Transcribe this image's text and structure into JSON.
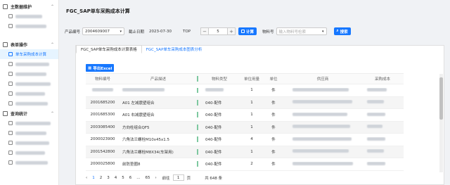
{
  "sidebar": {
    "groups": [
      {
        "label": "主数据维护",
        "items": [
          {
            "label": ""
          }
        ]
      },
      {
        "label": "表单操作",
        "items": [
          {
            "label": "单车采购成本计算",
            "active": true
          },
          {
            "label": ""
          },
          {
            "label": ""
          },
          {
            "label": ""
          },
          {
            "label": ""
          },
          {
            "label": ""
          }
        ]
      },
      {
        "label": "查询统计",
        "items": [
          {
            "label": ""
          },
          {
            "label": ""
          },
          {
            "label": ""
          },
          {
            "label": ""
          },
          {
            "label": ""
          },
          {
            "label": ""
          }
        ]
      }
    ]
  },
  "header": {
    "title": "FGC_SAP单车采购成本计算"
  },
  "filters": {
    "product_code_label": "产品编号",
    "product_code_value": "2004609007",
    "deadline_label": "截止日期",
    "deadline_value": "2023-07-30",
    "top_label": "TOP",
    "top_value": "5",
    "minus": "−",
    "plus": "+",
    "calc_button": "计算",
    "material_label": "物料号",
    "material_placeholder": "输入物料号检索",
    "search_button": "搜索"
  },
  "tabs": [
    {
      "label": "FGC_SAP单车采购成本计算表格",
      "active": true
    },
    {
      "label": "FGC_SAP单车采购成本图表分析",
      "active": false
    }
  ],
  "export_button": "导出Excel",
  "table": {
    "columns": [
      "物料编号",
      "产品描述",
      "物料类型",
      "单位用量",
      "单位",
      "供应商",
      "采购成本"
    ],
    "rows": [
      {
        "code": "",
        "desc": "",
        "type": "",
        "qty": "1",
        "unit": ""
      },
      {
        "code": "2001685200",
        "desc": "A01 左减震壁组合",
        "type": "040-配件",
        "qty": "1",
        "unit": "件"
      },
      {
        "code": "2001685300",
        "desc": "A01 右减震壁组合",
        "type": "040-配件",
        "qty": "1",
        "unit": "件"
      },
      {
        "code": "2003085400",
        "desc": "方向柱组合QF5",
        "type": "040-配件",
        "qty": "1",
        "unit": "件"
      },
      {
        "code": "2000023900",
        "desc": "六角法兰螺栓M10x45x1.5",
        "type": "040-配件",
        "qty": "4",
        "unit": "件"
      },
      {
        "code": "2001542800",
        "desc": "六角法兰螺栓M8X34(车架用)",
        "type": "040-配件",
        "qty": "1",
        "unit": "件"
      },
      {
        "code": "2000025800",
        "desc": "前防垫圈8",
        "type": "040-配件",
        "qty": "2",
        "unit": "件"
      }
    ]
  },
  "pagination": {
    "prev": "‹",
    "pages": [
      "1",
      "2",
      "3",
      "4",
      "5",
      "6",
      "...",
      "65"
    ],
    "next": "›",
    "goto_label": "前往",
    "goto_value": "1",
    "page_suffix": "页",
    "total": "共 648 条"
  }
}
